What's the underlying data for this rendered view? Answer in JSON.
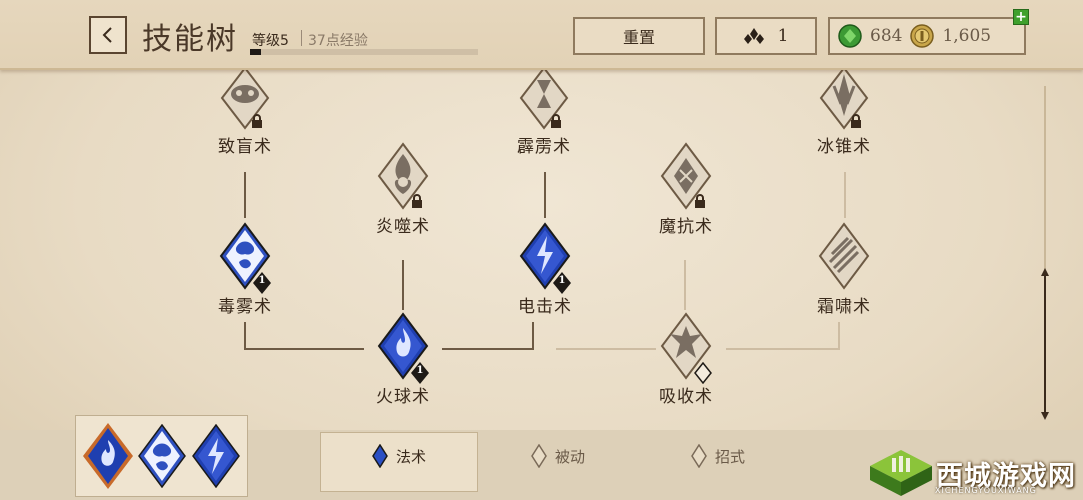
{
  "header": {
    "back_icon": "chevron-left-icon",
    "title": "技能树",
    "level": "等级5",
    "xp": "37点经验",
    "xp_progress": 0.05,
    "reset_label": "重置",
    "skill_points": "1",
    "gems": "684",
    "coins": "1,605",
    "plus_label": "+"
  },
  "skills": {
    "blind": "致盲术",
    "fire_devour": "炎噬术",
    "thunder": "霹雳术",
    "magic_resist": "魔抗术",
    "ice_cone": "冰锥术",
    "poison_fog": "毒雾术",
    "shock": "电击术",
    "frost_roar": "霜啸术",
    "fireball": "火球术",
    "absorb": "吸收术",
    "rank_poison_fog": "1",
    "rank_shock": "1",
    "rank_fireball": "1"
  },
  "tabs": {
    "spells": "法术",
    "passive": "被动",
    "moves": "招式"
  },
  "watermark": {
    "title": "西城游戏网",
    "subtitle": "XICHENGYOUXIWANG"
  },
  "colors": {
    "parchment": "#ece0cc",
    "ink": "#3a2a1c",
    "active_blue": "#2a4fc4",
    "locked_grey": "#d8cdbb"
  }
}
